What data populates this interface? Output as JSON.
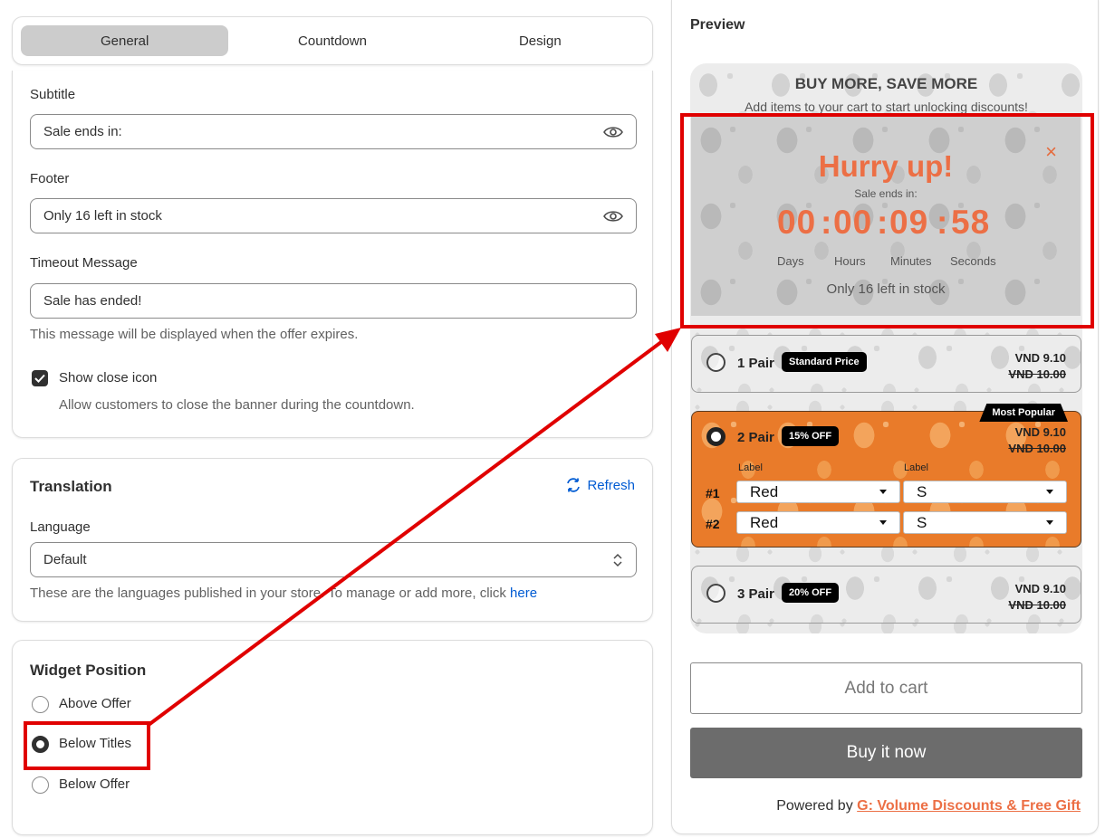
{
  "tabs": [
    {
      "label": "General",
      "active": true
    },
    {
      "label": "Countdown",
      "active": false
    },
    {
      "label": "Design",
      "active": false
    }
  ],
  "general": {
    "subtitle": {
      "label": "Subtitle",
      "value": "Sale ends in:"
    },
    "footer": {
      "label": "Footer",
      "value": "Only 16 left in stock"
    },
    "timeout": {
      "label": "Timeout Message",
      "value": "Sale has ended!",
      "help": "This message will be displayed when the offer expires."
    },
    "close_icon": {
      "label": "Show close icon",
      "checked": true,
      "help": "Allow customers to close the banner during the countdown."
    }
  },
  "translation": {
    "title": "Translation",
    "refresh": "Refresh",
    "language_label": "Language",
    "language_value": "Default",
    "help_prefix": "These are the languages published in your store. To manage or add more, click",
    "help_link": "here"
  },
  "widget_position": {
    "title": "Widget Position",
    "options": [
      {
        "label": "Above Offer",
        "checked": false
      },
      {
        "label": "Below Titles",
        "checked": true
      },
      {
        "label": "Below Offer",
        "checked": false
      }
    ]
  },
  "preview": {
    "title": "Preview",
    "bundle_title": "BUY MORE, SAVE MORE",
    "bundle_subtitle": "Add items to your cart to start unlocking discounts!",
    "timer": {
      "title": "Hurry up!",
      "subtitle": "Sale ends in:",
      "days": "00",
      "hours": "00",
      "minutes": "09",
      "seconds": "58",
      "sep": ":",
      "units": {
        "days": "Days",
        "hours": "Hours",
        "minutes": "Minutes",
        "seconds": "Seconds"
      },
      "footer": "Only 16 left in stock",
      "close": "×"
    },
    "offers": [
      {
        "name": "1 Pair",
        "badge": "Standard Price",
        "price": "VND 9.10",
        "old_price": "VND 10.00",
        "selected": false
      },
      {
        "name": "2 Pair",
        "badge": "15% OFF",
        "price": "VND 9.10",
        "old_price": "VND 10.00",
        "selected": true,
        "ribbon": "Most Popular",
        "option_labels": [
          "Label",
          "Label"
        ],
        "items": [
          {
            "num": "#1",
            "color": "Red",
            "size": "S"
          },
          {
            "num": "#2",
            "color": "Red",
            "size": "S"
          }
        ]
      },
      {
        "name": "3 Pair",
        "badge": "20% OFF",
        "price": "VND 9.10",
        "old_price": "VND 10.00",
        "selected": false
      }
    ],
    "add_to_cart": "Add to cart",
    "buy_now": "Buy it now",
    "powered_prefix": "Powered by",
    "powered_link": "G: Volume Discounts & Free Gift"
  },
  "colors": {
    "accent": "#ec6f45",
    "annotation": "#e00000",
    "selected_offer": "#e97b2a",
    "link": "#005bd3"
  }
}
